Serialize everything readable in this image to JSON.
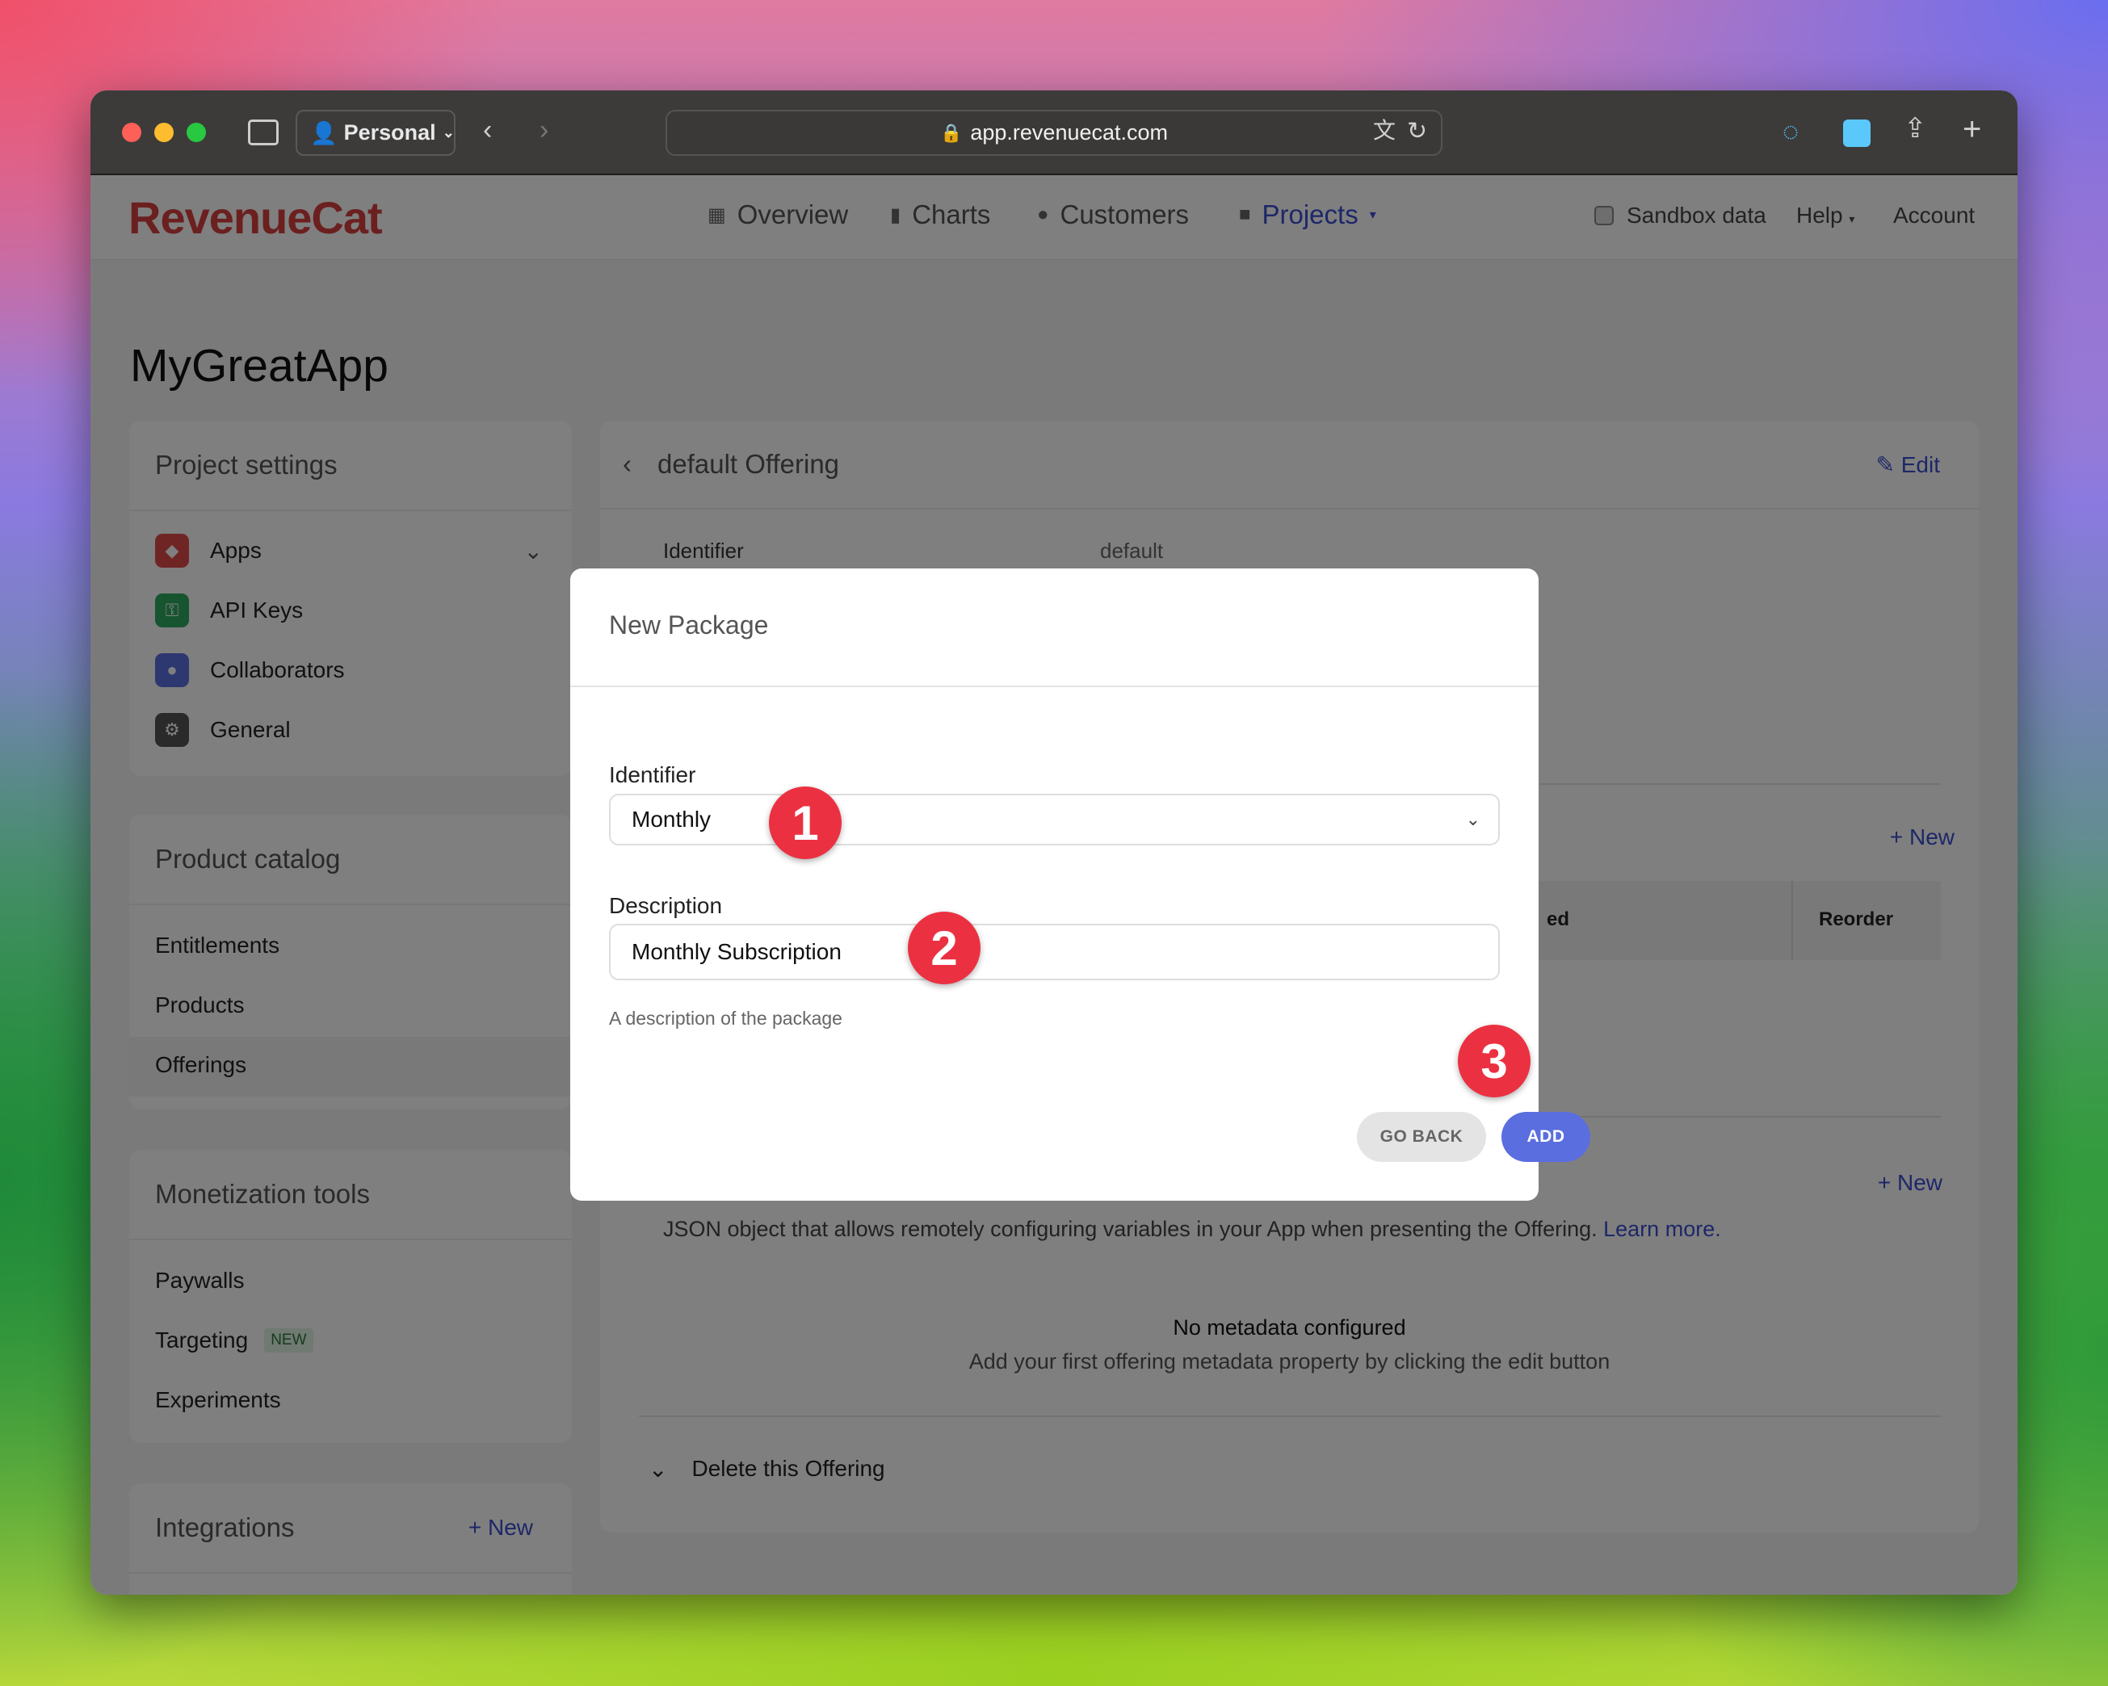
{
  "browser": {
    "profile": "Personal",
    "url": "app.revenuecat.com"
  },
  "nav": {
    "logo": "RevenueCat",
    "items": [
      {
        "label": "Overview",
        "icon": "grid-icon"
      },
      {
        "label": "Charts",
        "icon": "bar-chart-icon"
      },
      {
        "label": "Customers",
        "icon": "person-icon"
      },
      {
        "label": "Projects",
        "icon": "folder-icon"
      }
    ],
    "sandbox": "Sandbox data",
    "help": "Help",
    "account": "Account"
  },
  "page_title": "MyGreatApp",
  "sidebar": {
    "project_settings": {
      "title": "Project settings",
      "items": [
        {
          "label": "Apps",
          "color": "#e04a4a"
        },
        {
          "label": "API Keys",
          "color": "#2fa860"
        },
        {
          "label": "Collaborators",
          "color": "#5a6ee0"
        },
        {
          "label": "General",
          "color": "#555555"
        }
      ]
    },
    "product_catalog": {
      "title": "Product catalog",
      "items": [
        "Entitlements",
        "Products",
        "Offerings"
      ]
    },
    "monetization": {
      "title": "Monetization tools",
      "items": [
        "Paywalls",
        "Targeting",
        "Experiments"
      ],
      "new_badge": "NEW"
    },
    "integrations": {
      "title": "Integrations",
      "new": "New"
    }
  },
  "main": {
    "title": "default Offering",
    "edit": "Edit",
    "identifier_label": "Identifier",
    "identifier_value": "default",
    "packages_new": "New",
    "col_partial": "ed",
    "col_reorder": "Reorder",
    "metadata_new": "New",
    "metadata_desc": "JSON object that allows remotely configuring variables in your App when presenting the Offering.",
    "learn_more": "Learn more.",
    "empty_title": "No metadata configured",
    "empty_sub": "Add your first offering metadata property by clicking the edit button",
    "delete": "Delete this Offering"
  },
  "modal": {
    "title": "New Package",
    "identifier_label": "Identifier",
    "identifier_value": "Monthly",
    "description_label": "Description",
    "description_value": "Monthly Subscription",
    "description_help": "A description of the package",
    "go_back": "GO BACK",
    "add": "ADD"
  },
  "annotations": [
    "1",
    "2",
    "3"
  ],
  "colors": {
    "accent": "#5a6ee0",
    "brand": "#d6413f",
    "badge": "#eb3141"
  }
}
